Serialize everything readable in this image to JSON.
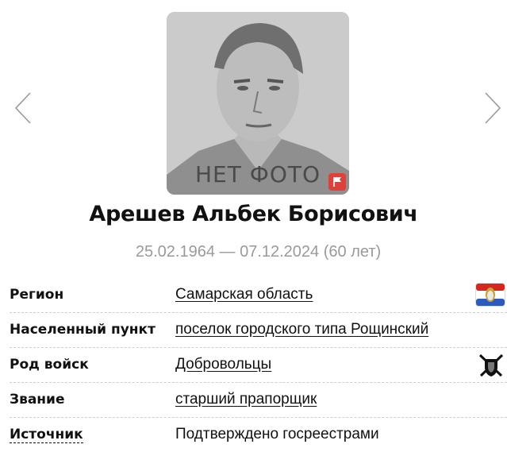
{
  "photo": {
    "placeholder_text": "НЕТ ФОТО",
    "report_icon": "flag-icon"
  },
  "navigation": {
    "prev_icon": "chevron-left-icon",
    "next_icon": "chevron-right-icon"
  },
  "person": {
    "full_name": "Арешев Альбек Борисович",
    "dates": "25.02.1964 — 07.12.2024 (60 лет)"
  },
  "details": [
    {
      "label": "Регион",
      "value": "Самарская область",
      "icon": "samara-region-flag-icon"
    },
    {
      "label": "Населенный пункт",
      "value": "поселок городского типа Рощинский"
    },
    {
      "label": "Род войск",
      "value": "Добровольцы",
      "icon": "volunteers-emblem-icon"
    },
    {
      "label": "Звание",
      "value": "старший прапорщик"
    },
    {
      "label": "Источник",
      "value": "Подтверждено госреестрами"
    }
  ],
  "colors": {
    "report_flag": "#e0403a",
    "dates_text": "#9a9a9a",
    "photo_bg": "#c9c9c9"
  }
}
